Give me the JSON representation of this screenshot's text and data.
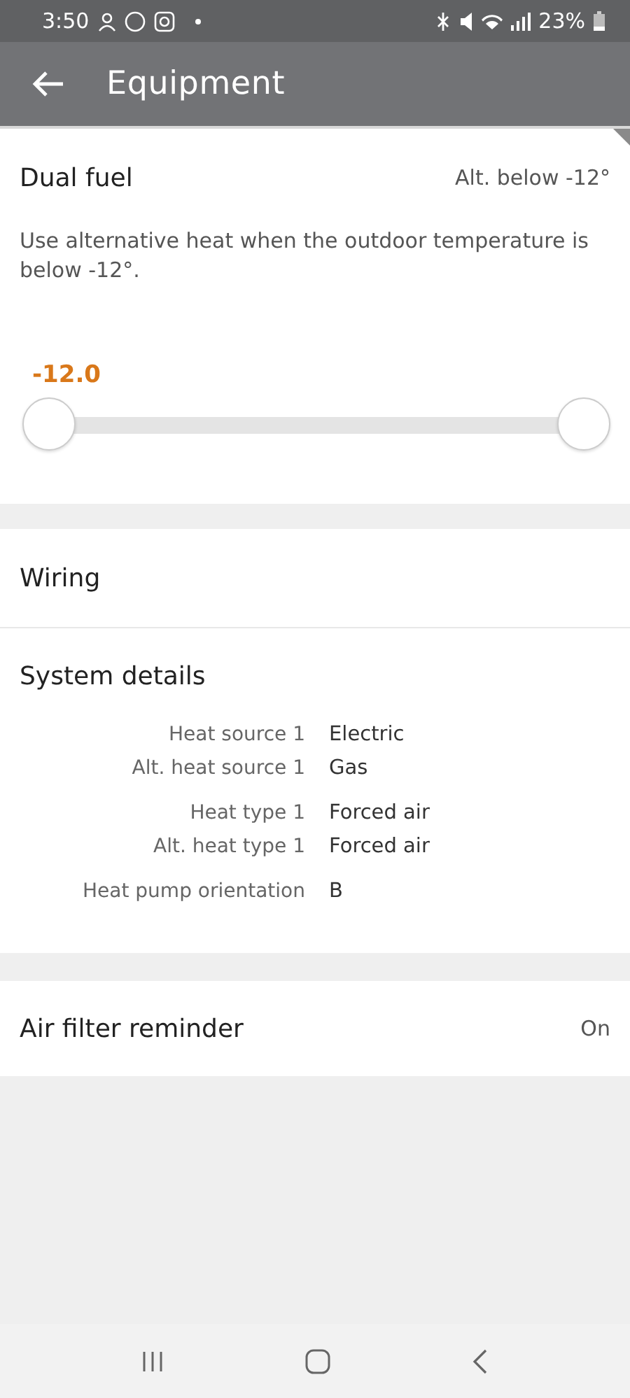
{
  "status_bar": {
    "time": "3:50",
    "battery": "23%"
  },
  "app_bar": {
    "title": "Equipment"
  },
  "dual_fuel": {
    "title": "Dual fuel",
    "value": "Alt. below -12°",
    "description": "Use alternative heat when the outdoor temperature is below -12°.",
    "slider": {
      "reading": "-12.0",
      "thumbs": [
        {
          "level": 0
        },
        {
          "level": 1
        }
      ]
    }
  },
  "wiring": {
    "title": "Wiring"
  },
  "system_details": {
    "title": "System details",
    "groups": [
      {
        "rows": [
          {
            "label": "Heat source 1",
            "value": "Electric"
          },
          {
            "label": "Alt. heat source 1",
            "value": "Gas"
          }
        ]
      },
      {
        "rows": [
          {
            "label": "Heat type 1",
            "value": "Forced air"
          },
          {
            "label": "Alt. heat type 1",
            "value": "Forced air"
          }
        ]
      },
      {
        "rows": [
          {
            "label": "Heat pump orientation",
            "value": "B"
          }
        ]
      }
    ]
  },
  "air_filter": {
    "title": "Air filter reminder",
    "value": "On"
  }
}
